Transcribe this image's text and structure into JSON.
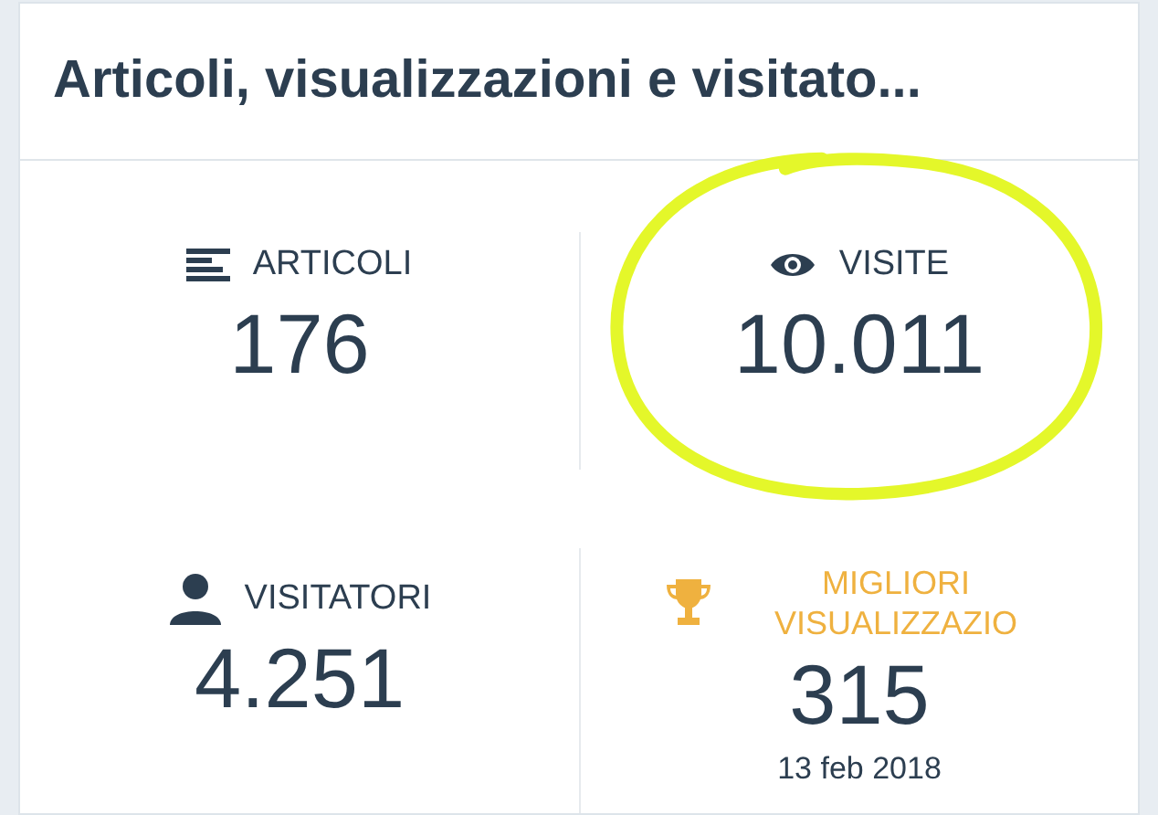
{
  "card": {
    "title": "Articoli, visualizzazioni e visitato..."
  },
  "stats": [
    {
      "kind": "articles",
      "label": "ARTICOLI",
      "value": "176",
      "circled": false
    },
    {
      "kind": "views",
      "label": "VISITE",
      "value": "10.011",
      "circled": true
    },
    {
      "kind": "visitors",
      "label": "VISITATORI",
      "value": "4.251",
      "circled": false
    },
    {
      "kind": "best",
      "label": "MIGLIORI VISUALIZZAZIO",
      "value": "315",
      "date": "13 feb 2018",
      "circled": false
    }
  ]
}
